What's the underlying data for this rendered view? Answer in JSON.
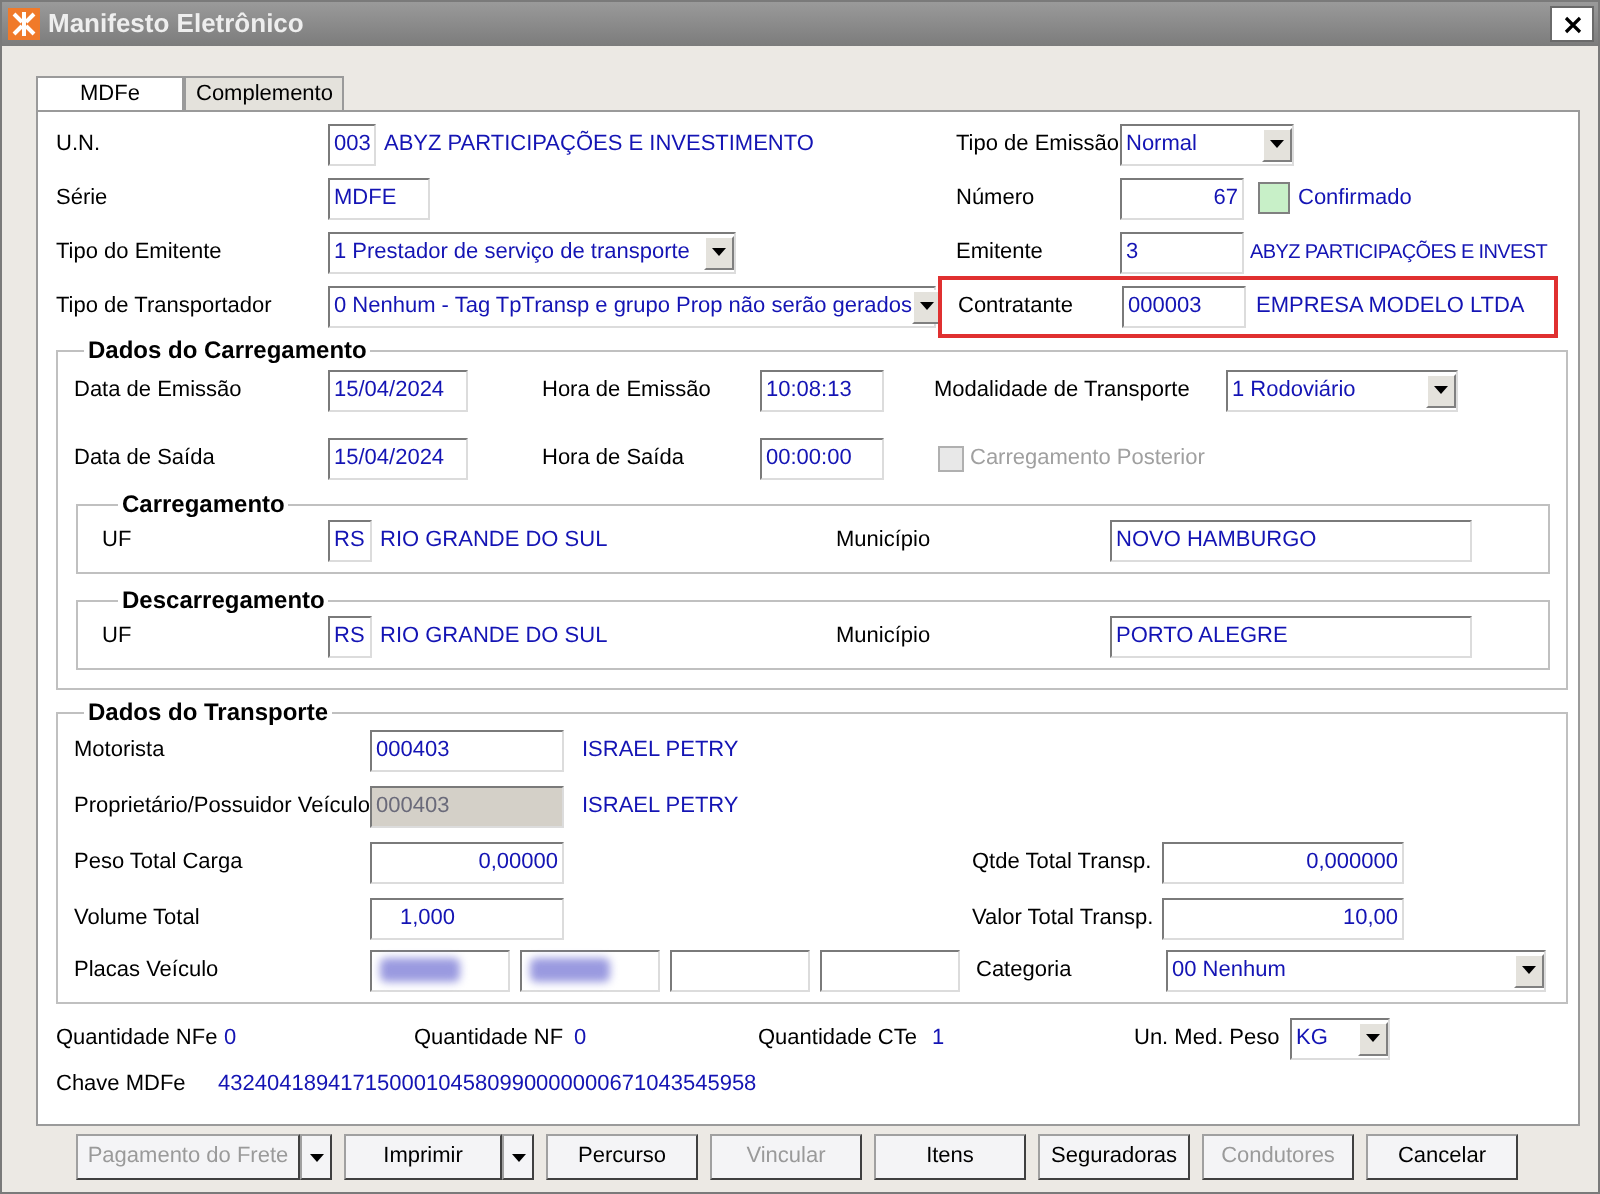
{
  "window": {
    "title": "Manifesto Eletrônico"
  },
  "tabs": [
    {
      "label": "MDFe",
      "selected": true
    },
    {
      "label": "Complemento",
      "selected": false
    }
  ],
  "identification": {
    "un": {
      "label": "U.N.",
      "value": "003",
      "description": "ABYZ PARTICIPAÇÕES E INVESTIMENTO"
    },
    "serie": {
      "label": "Série",
      "value": "MDFE"
    },
    "tipo_emitente": {
      "label": "Tipo do Emitente",
      "value": "1 Prestador de serviço de transporte"
    },
    "tipo_transportador": {
      "label": "Tipo de Transportador",
      "value": "0 Nenhum - Tag TpTransp e grupo Prop não serão gerados"
    },
    "tipo_emissao": {
      "label": "Tipo de Emissão",
      "value": "Normal"
    },
    "numero": {
      "label": "Número",
      "value": "67",
      "status": {
        "label": "Confirmado",
        "confirmed": true
      }
    },
    "emitente": {
      "label": "Emitente",
      "value": "3",
      "description": "ABYZ PARTICIPAÇÕES E INVEST"
    },
    "contratante": {
      "label": "Contratante",
      "value": "000003",
      "description": "EMPRESA MODELO LTDA",
      "highlighted": true
    }
  },
  "carregamento": {
    "title": "Dados do Carregamento",
    "data_emissao": {
      "label": "Data de Emissão",
      "value": "15/04/2024"
    },
    "hora_emissao": {
      "label": "Hora de Emissão",
      "value": "10:08:13"
    },
    "modalidade": {
      "label": "Modalidade de Transporte",
      "value": "1 Rodoviário"
    },
    "data_saida": {
      "label": "Data de Saída",
      "value": "15/04/2024"
    },
    "hora_saida": {
      "label": "Hora de Saída",
      "value": "00:00:00"
    },
    "carregamento_posterior": {
      "label": "Carregamento Posterior",
      "checked": false,
      "disabled": true
    },
    "places": [
      {
        "title": "Carregamento",
        "uf_label": "UF",
        "uf": "RS",
        "uf_name": "RIO GRANDE DO SUL",
        "municipio_label": "Município",
        "municipio": "NOVO HAMBURGO"
      },
      {
        "title": "Descarregamento",
        "uf_label": "UF",
        "uf": "RS",
        "uf_name": "RIO GRANDE DO SUL",
        "municipio_label": "Município",
        "municipio": "PORTO ALEGRE"
      }
    ]
  },
  "transporte": {
    "title": "Dados do Transporte",
    "motorista": {
      "label": "Motorista",
      "value": "000403",
      "description": "ISRAEL PETRY"
    },
    "proprietario": {
      "label": "Proprietário/Possuidor Veículo",
      "value": "000403",
      "description": "ISRAEL PETRY",
      "disabled": true
    },
    "peso": {
      "label": "Peso Total Carga",
      "value": "0,00000"
    },
    "qtde": {
      "label": "Qtde Total Transp.",
      "value": "0,000000"
    },
    "volume": {
      "label": "Volume Total",
      "value": "1,000"
    },
    "valor": {
      "label": "Valor Total Transp.",
      "value": "10,00"
    },
    "placas": {
      "label": "Placas Veículo",
      "fields": [
        {
          "redacted": true
        },
        {
          "redacted": true
        },
        {
          "redacted": false
        },
        {
          "redacted": false
        }
      ]
    },
    "categoria": {
      "label": "Categoria",
      "value": "00 Nenhum"
    }
  },
  "quantities": [
    {
      "label": "Quantidade NFe",
      "value": "0"
    },
    {
      "label": "Quantidade NF",
      "value": "0"
    },
    {
      "label": "Quantidade CTe",
      "value": "1"
    }
  ],
  "un_med_peso": {
    "label": "Un. Med. Peso",
    "value": "KG"
  },
  "chave": {
    "label": "Chave MDFe",
    "value": "43240418941715000104580990000000671043545958"
  },
  "buttons": [
    {
      "label": "Pagamento do Frete",
      "disabled": true,
      "dropdown": true
    },
    {
      "label": "Imprimir",
      "disabled": false,
      "dropdown": true
    },
    {
      "label": "Percurso",
      "disabled": false,
      "dropdown": false
    },
    {
      "label": "Vincular",
      "disabled": true,
      "dropdown": false
    },
    {
      "label": "Itens",
      "disabled": false,
      "dropdown": false
    },
    {
      "label": "Seguradoras",
      "disabled": false,
      "dropdown": false
    },
    {
      "label": "Condutores",
      "disabled": true,
      "dropdown": false
    },
    {
      "label": "Cancelar",
      "disabled": false,
      "dropdown": false
    }
  ]
}
